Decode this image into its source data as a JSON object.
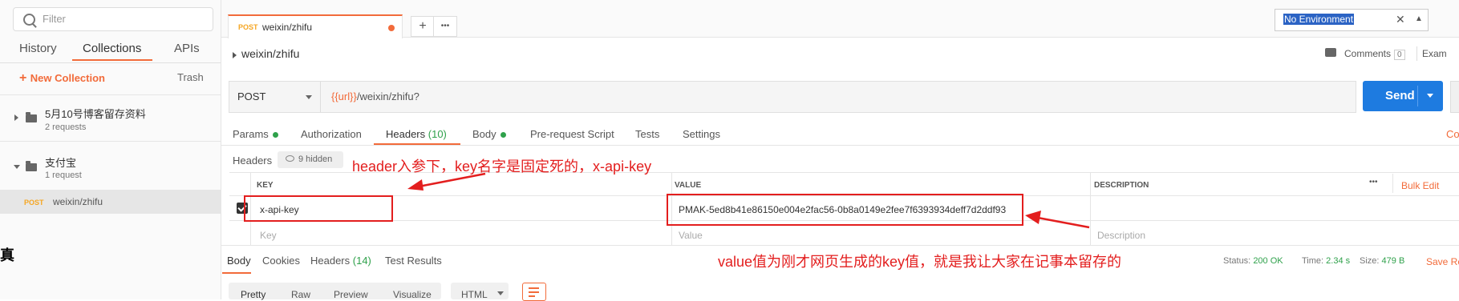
{
  "sidebar": {
    "search_placeholder": "Filter",
    "tabs": [
      "History",
      "Collections",
      "APIs"
    ],
    "new_collection": "New Collection",
    "trash": "Trash",
    "collections": [
      {
        "name": "5月10号博客留存资料",
        "sub": "2 requests"
      },
      {
        "name": "支付宝",
        "sub": "1 request"
      }
    ],
    "request": {
      "method": "POST",
      "name": "weixin/zhifu"
    },
    "edge_glyph": "真"
  },
  "tabbar": {
    "tab_method": "POST",
    "tab_name": "weixin/zhifu",
    "plus": "+",
    "more": "•••",
    "environment": "No Environment",
    "env_clear": "✕",
    "env_arrow": "▲"
  },
  "request": {
    "breadcrumb": "weixin/zhifu",
    "comments_label": "Comments",
    "comments_count": "0",
    "examples": "Exam",
    "method": "POST",
    "url_var": "{{url}}",
    "url_path": "/weixin/zhifu?",
    "send": "Send",
    "tabs": {
      "params": "Params",
      "authorization": "Authorization",
      "headers": "Headers",
      "headers_count": "(10)",
      "body": "Body",
      "prerequest": "Pre-request Script",
      "tests": "Tests",
      "settings": "Settings",
      "cookies_stub": "Co"
    },
    "headers_label": "Headers",
    "hidden": "9 hidden"
  },
  "table": {
    "columns": {
      "key": "KEY",
      "value": "VALUE",
      "description": "DESCRIPTION"
    },
    "more": "•••",
    "bulk_edit": "Bulk Edit",
    "row": {
      "key": "x-api-key",
      "value": "PMAK-5ed8b41e86150e004e2fac56-0b8a0149e2fee7f6393934deff7d2ddf93"
    },
    "placeholders": {
      "key": "Key",
      "value": "Value",
      "description": "Description"
    }
  },
  "annotations": {
    "header_note": "header入参下，key名字是固定死的，x-api-key",
    "value_note": "value值为刚才网页生成的key值，就是我让大家在记事本留存的"
  },
  "response": {
    "tabs": {
      "body": "Body",
      "cookies": "Cookies",
      "headers": "Headers",
      "headers_count": "(14)",
      "tests": "Test Results"
    },
    "status_label": "Status:",
    "status_value": "200 OK",
    "time_label": "Time:",
    "time_value": "2.34 s",
    "size_label": "Size:",
    "size_value": "479 B",
    "save": "Save Re",
    "formats": [
      "Pretty",
      "Raw",
      "Preview",
      "Visualize"
    ],
    "lang": "HTML"
  },
  "colors": {
    "accent": "#f26b3a",
    "send": "#1e7be0",
    "annotation": "#e31e1e",
    "success": "#2fa14b"
  }
}
